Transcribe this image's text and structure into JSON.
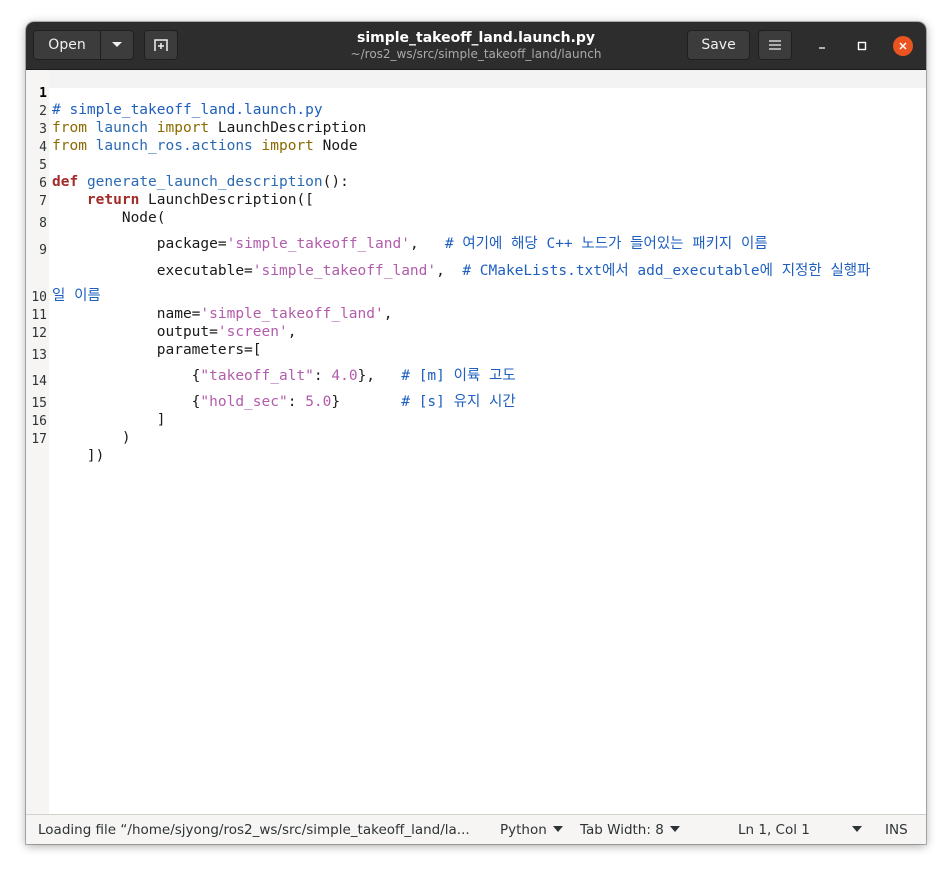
{
  "headerbar": {
    "open_label": "Open",
    "save_label": "Save",
    "title": "simple_takeoff_land.launch.py",
    "subtitle": "~/ros2_ws/src/simple_takeoff_land/launch",
    "icons": {
      "open_menu": "chevron-down-icon",
      "new_tab": "new-tab-icon",
      "menu": "hamburger-menu-icon",
      "minimize": "minimize-icon",
      "maximize": "maximize-icon",
      "close": "close-icon"
    },
    "close_color": "#e95420"
  },
  "editor": {
    "current_line": 1,
    "lines": [
      {
        "n": "1",
        "code": "# simple_takeoff_land.launch.py"
      },
      {
        "n": "2",
        "code": "from launch import LaunchDescription"
      },
      {
        "n": "3",
        "code": "from launch_ros.actions import Node"
      },
      {
        "n": "4",
        "code": ""
      },
      {
        "n": "5",
        "code": "def generate_launch_description():"
      },
      {
        "n": "6",
        "code": "    return LaunchDescription(["
      },
      {
        "n": "7",
        "code": "        Node("
      },
      {
        "n": "8",
        "code": "            package='simple_takeoff_land',   # 여기에 해당 C++ 노드가 들어있는 패키지 이름"
      },
      {
        "n": "9",
        "code": "            executable='simple_takeoff_land',  # CMakeLists.txt에서 add_executable에 지정한 실행파"
      },
      {
        "n": "",
        "code": "일 이름"
      },
      {
        "n": "10",
        "code": "            name='simple_takeoff_land',"
      },
      {
        "n": "11",
        "code": "            output='screen',"
      },
      {
        "n": "12",
        "code": "            parameters=["
      },
      {
        "n": "13",
        "code": "                {\"takeoff_alt\": 4.0},   # [m] 이륙 고도"
      },
      {
        "n": "14",
        "code": "                {\"hold_sec\": 5.0}       # [s] 유지 시간"
      },
      {
        "n": "15",
        "code": "            ]"
      },
      {
        "n": "16",
        "code": "        )"
      },
      {
        "n": "17",
        "code": "    ])"
      }
    ]
  },
  "statusbar": {
    "status": "Loading file “/home/sjyong/ros2_ws/src/simple_takeoff_land/la...",
    "language": "Python",
    "tab_width": "Tab Width: 8",
    "position": "Ln 1, Col 1",
    "mode": "INS"
  }
}
